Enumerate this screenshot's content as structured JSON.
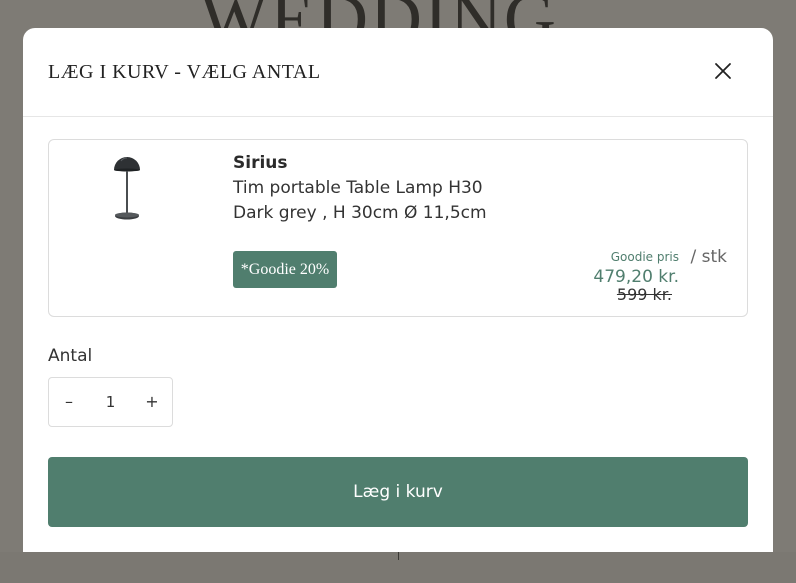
{
  "background": {
    "title": "WEDDING"
  },
  "modal": {
    "title": "LÆG I KURV - VÆLG ANTAL",
    "close_icon": "close-icon"
  },
  "product": {
    "brand": "Sirius",
    "name": "Tim portable Table Lamp H30",
    "variant": "Dark grey , H 30cm Ø 11,5cm",
    "badge": "*Goodie 20%",
    "price_label": "Goodie pris",
    "price_now": "479,20 kr.",
    "price_old": "599 kr.",
    "price_unit": "/ stk",
    "image_icon": "table-lamp-image"
  },
  "quantity": {
    "label": "Antal",
    "value": "1",
    "minus": "–",
    "plus": "+"
  },
  "cart_button": {
    "label": "Læg i kurv"
  },
  "colors": {
    "accent": "#507e6e",
    "overlay": "#7e7b75"
  }
}
